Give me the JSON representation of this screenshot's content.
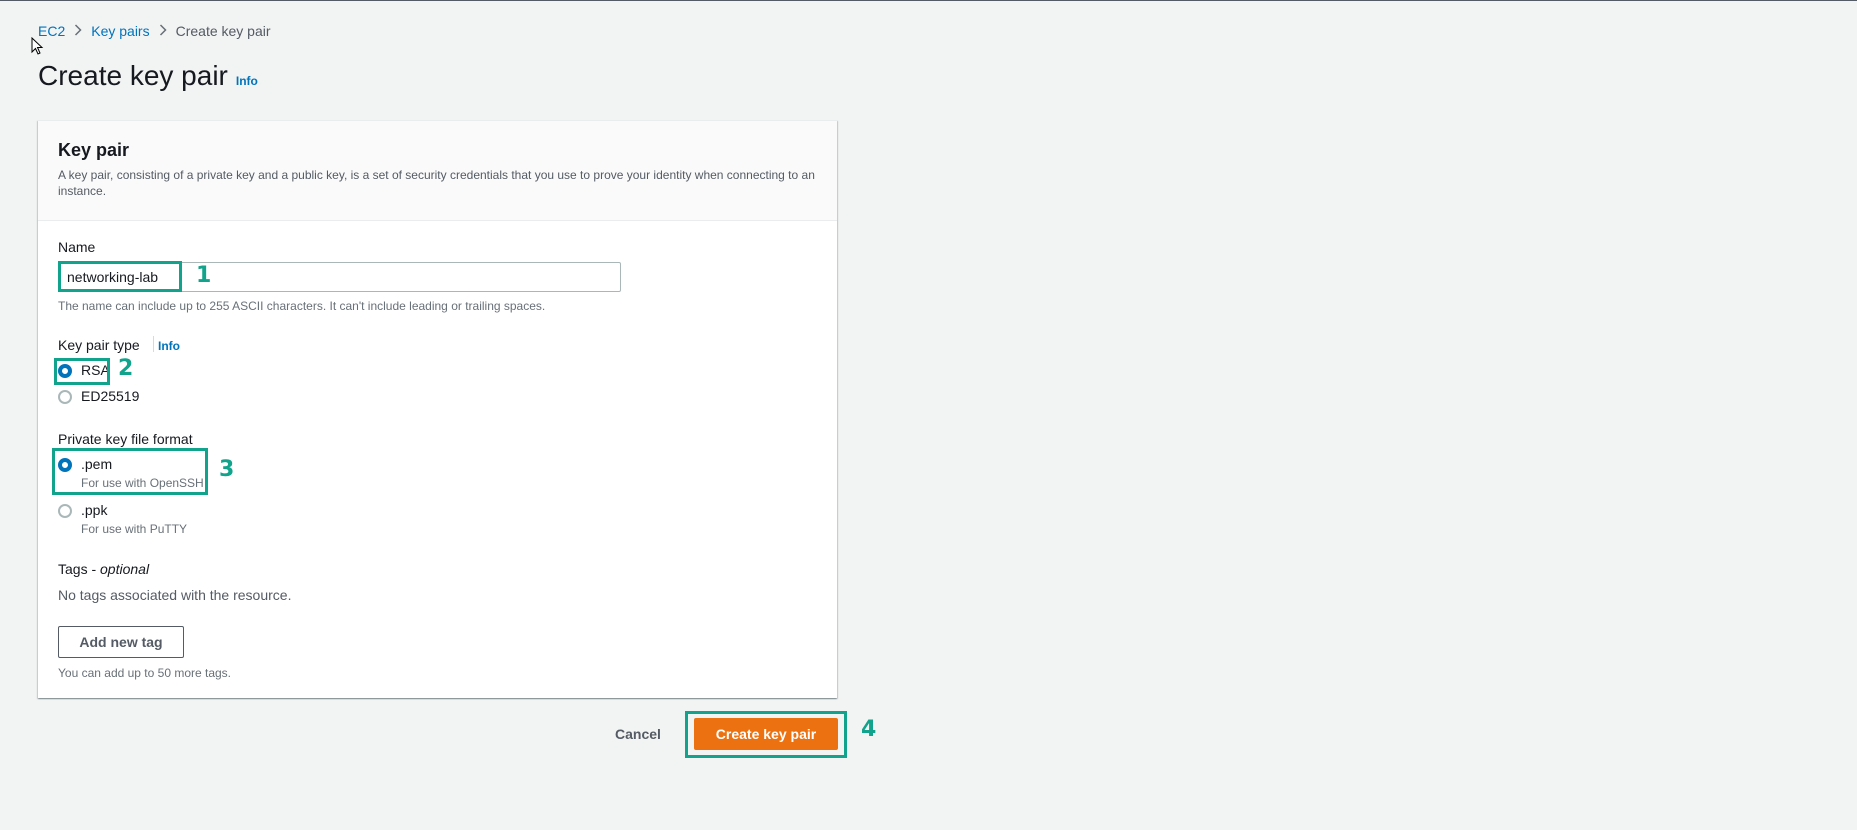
{
  "breadcrumb": {
    "items": [
      "EC2",
      "Key pairs"
    ],
    "current": "Create key pair"
  },
  "page": {
    "title": "Create key pair",
    "info": "Info"
  },
  "panel": {
    "title": "Key pair",
    "description": "A key pair, consisting of a private key and a public key, is a set of security credentials that you use to prove your identity when connecting to an instance."
  },
  "form": {
    "name_label": "Name",
    "name_value": "networking-lab",
    "name_hint": "The name can include up to 255 ASCII characters. It can't include leading or trailing spaces.",
    "type_label": "Key pair type",
    "type_info": "Info",
    "type_options": [
      {
        "label": "RSA",
        "selected": true
      },
      {
        "label": "ED25519",
        "selected": false
      }
    ],
    "format_label": "Private key file format",
    "format_options": [
      {
        "label": ".pem",
        "desc": "For use with OpenSSH",
        "selected": true
      },
      {
        "label": ".ppk",
        "desc": "For use with PuTTY",
        "selected": false
      }
    ],
    "tags_label": "Tags - ",
    "tags_optional": "optional",
    "tags_empty": "No tags associated with the resource.",
    "add_tag_button": "Add new tag",
    "tags_hint": "You can add up to 50 more tags."
  },
  "actions": {
    "cancel": "Cancel",
    "create": "Create key pair"
  },
  "annotations": [
    "1",
    "2",
    "3",
    "4"
  ],
  "colors": {
    "link": "#0073bb",
    "primary_button": "#ec7211",
    "annotation": "#11a38b",
    "background": "#f2f3f3"
  }
}
